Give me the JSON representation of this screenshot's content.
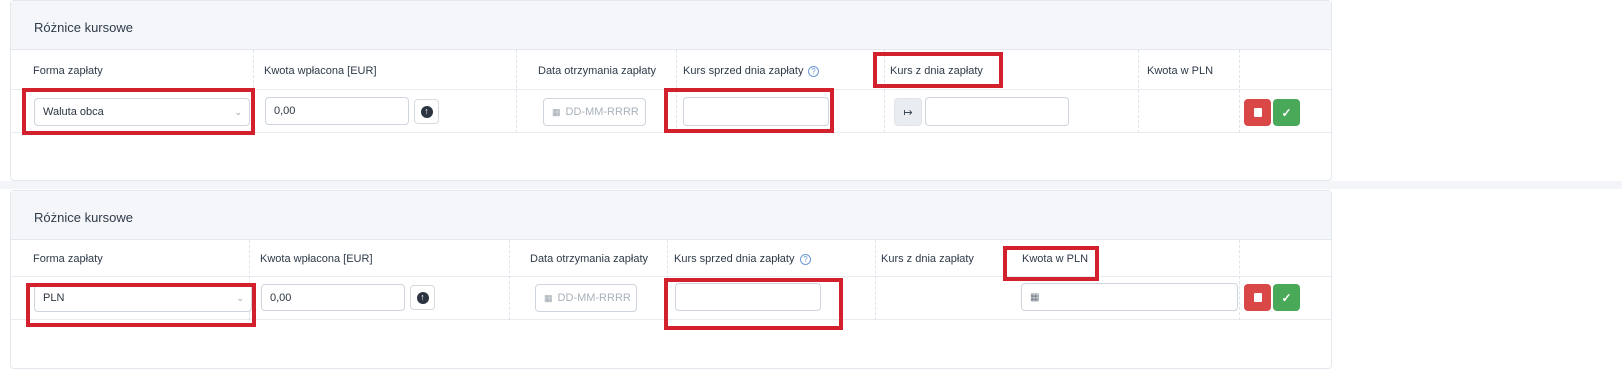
{
  "section_title": "Różnice kursowe",
  "columns": {
    "forma_zaplaty": "Forma zapłaty",
    "kwota_wplacona": "Kwota wpłacona [EUR]",
    "data_otrzymania": "Data otrzymania zapłaty",
    "kurs_sprzed": "Kurs sprzed dnia zapłaty",
    "kurs_z_dnia": "Kurs z dnia zapłaty",
    "kwota_w_pln": "Kwota w PLN"
  },
  "panel1": {
    "payment_form_value": "Waluta obca",
    "amount_value": "0,00",
    "date_placeholder": "DD-MM-RRRR"
  },
  "panel2": {
    "payment_form_value": "PLN",
    "amount_value": "0,00",
    "date_placeholder": "DD-MM-RRRR"
  },
  "colors": {
    "highlight": "#d2212c",
    "delete": "#d94746",
    "confirm": "#4aa859",
    "header_bg": "#f4f6f9"
  },
  "icons": [
    "chevron-down-icon",
    "arrow-up-circle-icon",
    "calendar-icon",
    "help-icon",
    "arrow-right-to-bracket-icon",
    "calculator-icon",
    "trash-icon",
    "check-icon"
  ]
}
